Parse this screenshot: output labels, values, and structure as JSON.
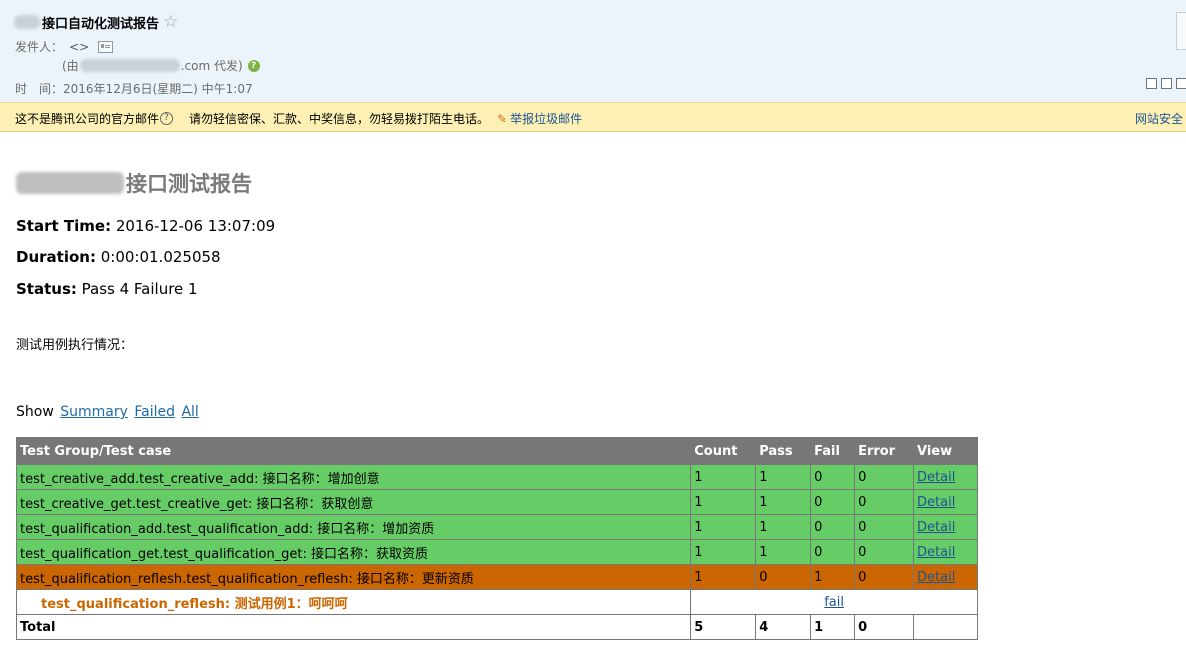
{
  "mail": {
    "subject": "接口自动化测试报告",
    "star_glyph": "☆",
    "sender_label": "发件人：",
    "sender_value": "<>",
    "proxy_prefix": "(由",
    "proxy_suffix": ".com 代发)",
    "time_label": "时　间：",
    "time_value": "2016年12月6日(星期二) 中午1:07"
  },
  "warning": {
    "text1": "这不是腾讯公司的官方邮件",
    "text2": "请勿轻信密保、汇款、中奖信息，勿轻易拨打陌生电话。",
    "report_link": "举报垃圾邮件",
    "right_link": "网站安全"
  },
  "report": {
    "title": "接口测试报告",
    "start_time_label": "Start Time:",
    "start_time": "2016-12-06 13:07:09",
    "duration_label": "Duration:",
    "duration": "0:00:01.025058",
    "status_label": "Status:",
    "status": "Pass 4 Failure 1",
    "case_heading": "测试用例执行情况：",
    "show_label": "Show",
    "filters": [
      "Summary",
      "Failed",
      "All"
    ]
  },
  "table": {
    "headers": [
      "Test Group/Test case",
      "Count",
      "Pass",
      "Fail",
      "Error",
      "View"
    ],
    "rows": [
      {
        "name": "test_creative_add.test_creative_add: 接口名称：增加创意",
        "count": "1",
        "pass": "1",
        "fail": "0",
        "error": "0",
        "view": "Detail"
      },
      {
        "name": "test_creative_get.test_creative_get: 接口名称：获取创意",
        "count": "1",
        "pass": "1",
        "fail": "0",
        "error": "0",
        "view": "Detail"
      },
      {
        "name": "test_qualification_add.test_qualification_add: 接口名称：增加资质",
        "count": "1",
        "pass": "1",
        "fail": "0",
        "error": "0",
        "view": "Detail"
      },
      {
        "name": "test_qualification_get.test_qualification_get: 接口名称：获取资质",
        "count": "1",
        "pass": "1",
        "fail": "0",
        "error": "0",
        "view": "Detail"
      },
      {
        "name": "test_qualification_reflesh.test_qualification_reflesh: 接口名称：更新资质",
        "count": "1",
        "pass": "0",
        "fail": "1",
        "error": "0",
        "view": "Detail"
      }
    ],
    "failed_case": {
      "name": "test_qualification_reflesh: 测试用例1：呵呵呵",
      "link": "fail"
    },
    "total": {
      "label": "Total",
      "count": "5",
      "pass": "4",
      "fail": "1",
      "error": "0"
    }
  },
  "colors": {
    "pass_row": "#66cc66",
    "fail_row": "#cc6600",
    "header_row": "#777777",
    "link": "#1e5494",
    "mail_header_bg": "#ebf4fb",
    "warning_bg": "#fcf0b4"
  }
}
